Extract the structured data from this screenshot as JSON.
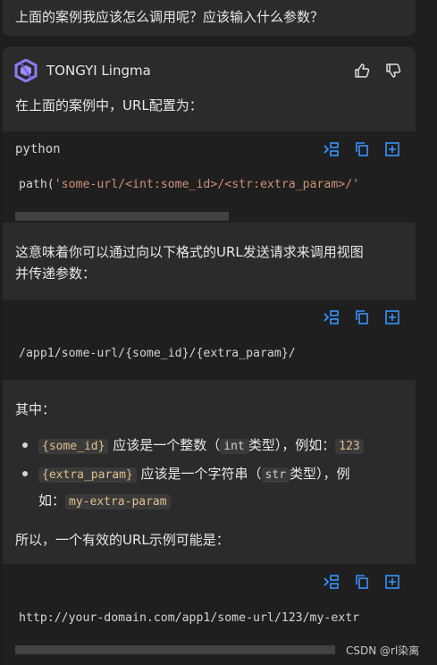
{
  "question": "上面的案例我应该怎么调用呢？应该输入什么参数？",
  "header": {
    "brand": "TONGYI Lingma",
    "logo_icon": "tongyi-logo-icon",
    "like_icon": "thumbs-up-icon",
    "dislike_icon": "thumbs-down-icon"
  },
  "answer": {
    "intro": "在上面的案例中，URL配置为：",
    "code1": {
      "lang": "python",
      "prefix": "path(",
      "string": "'some-url/<int:some_id>/<str:extra_param>/'"
    },
    "para2_line1": "这意味着你可以通过向以下格式的URL发送请求来调用视图",
    "para2_line2": "并传递参数：",
    "code2": {
      "line": "/app1/some-url/{some_id}/{extra_param}/"
    },
    "where": "其中：",
    "bullets": [
      {
        "code": "{some_id}",
        "t1": "应该是一个整数（",
        "type": "int",
        "t2": "类型），例如：",
        "example": "123"
      },
      {
        "code": "{extra_param}",
        "t1": "应该是一个字符串（",
        "type": "str",
        "t2": "类型），例",
        "t3": "如：",
        "example": "my-extra-param"
      }
    ],
    "conclusion": "所以，一个有效的URL示例可能是：",
    "code3": {
      "line": "http://your-domain.com/app1/some-url/123/my-extr"
    }
  },
  "code_actions": {
    "insert_icon": "insert-code-icon",
    "copy_icon": "copy-icon",
    "new_file_icon": "new-file-icon"
  },
  "colors": {
    "background": "#1e1e1e",
    "card": "#2b2b2b",
    "code_bg": "#1f1f1f",
    "accent": "#3794ff",
    "string": "#ce9178",
    "inline_code": "#e2c08d"
  },
  "watermark": "CSDN @rl染离"
}
